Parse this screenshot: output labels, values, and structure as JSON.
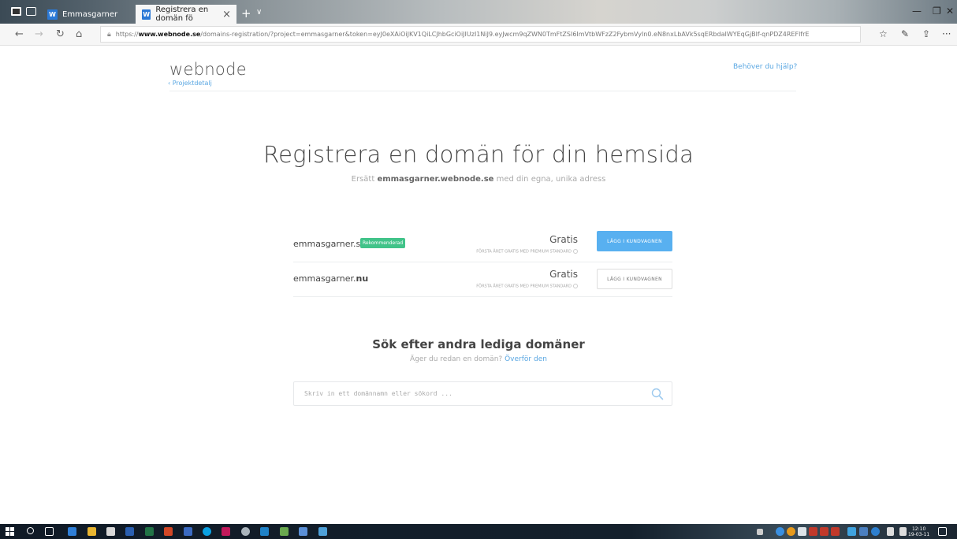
{
  "browser": {
    "tabs": [
      {
        "label": "Emmasgarner",
        "favicon": "W"
      },
      {
        "label": "Registrera en domän fö",
        "favicon": "W"
      }
    ],
    "url_prefix": "https://",
    "url_domain": "www.webnode.se",
    "url_rest": "/domains-registration/?project=emmasgarner&token=eyJ0eXAiOiJKV1QiLCJhbGciOiJIUzI1NiJ9.eyJwcm9qZWN0TmFtZSI6ImVtbWFzZ2FybmVyIn0.eN8nxLbAVk5sqERbdaIWYEqGjBlf-qnPDZ4REFlfrE"
  },
  "header": {
    "logo": "webnode",
    "back_link": "‹ Projektdetalj",
    "help_link": "Behöver du hjälp?"
  },
  "hero": {
    "title": "Registrera en domän för din hemsida",
    "subtitle_before": "Ersätt ",
    "subtitle_domain": "emmasgarner.webnode.se",
    "subtitle_after": " med din egna, unika adress"
  },
  "domains": [
    {
      "name": "emmasgarner.se",
      "badge": "Rekommenderad",
      "price": "Gratis",
      "note": "FÖRSTA ÅRET GRATIS MED PREMIUM STANDARD",
      "button": "LÄGG I KUNDVAGNEN"
    },
    {
      "name_base": "emmasgarner.",
      "name_tld": "nu",
      "price": "Gratis",
      "note": "FÖRSTA ÅRET GRATIS MED PREMIUM STANDARD",
      "button": "LÄGG I KUNDVAGNEN"
    }
  ],
  "search": {
    "title": "Sök efter andra lediga domäner",
    "subtitle": "Äger du redan en domän?",
    "transfer_link": "Överför den",
    "placeholder": "Skriv in ett domännamn eller sökord ...",
    "value": ""
  },
  "taskbar": {
    "time": "12:10",
    "date": "19-03-11"
  },
  "colors": {
    "accent_blue": "#58b0f0",
    "link_blue": "#5aa7e2",
    "badge_green": "#41c389"
  }
}
